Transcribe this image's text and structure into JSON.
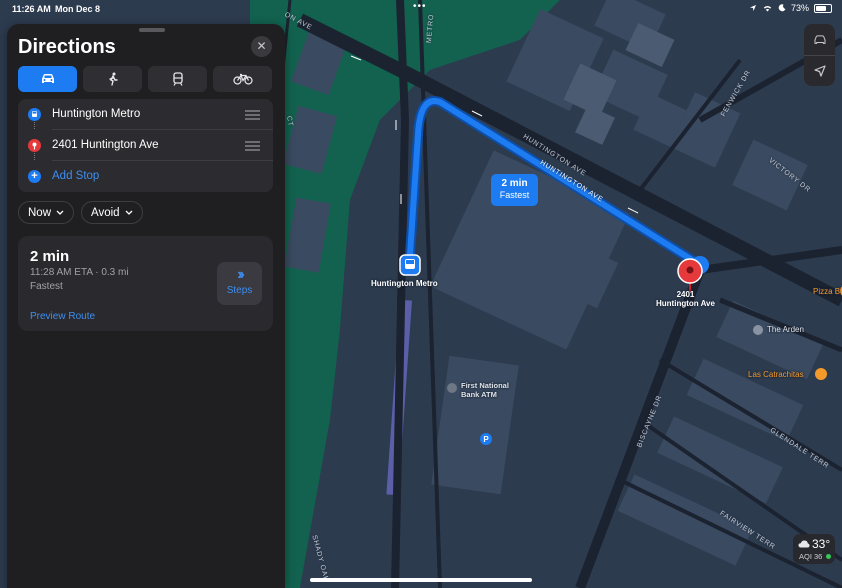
{
  "status_bar": {
    "time": "11:26 AM",
    "date": "Mon Dec 8",
    "battery": "73%",
    "battery_level": 0.73
  },
  "panel": {
    "title": "Directions",
    "close_icon": "xmark-icon",
    "transport_modes": [
      {
        "name": "car-icon",
        "active": true
      },
      {
        "name": "walk-icon",
        "active": false
      },
      {
        "name": "transit-icon",
        "active": false
      },
      {
        "name": "bike-icon",
        "active": false
      }
    ],
    "stops": [
      {
        "label": "Huntington Metro",
        "icon": "transit-stop-icon",
        "color": "#1d7cf2"
      },
      {
        "label": "2401 Huntington Ave",
        "icon": "pin-icon",
        "color": "#e5393b"
      }
    ],
    "add_stop_label": "Add Stop",
    "options": {
      "when_label": "Now",
      "avoid_label": "Avoid"
    },
    "route": {
      "duration": "2 min",
      "eta": "11:28 AM ETA · 0.3 mi",
      "tag": "Fastest",
      "steps_label": "Steps",
      "preview_label": "Preview Route"
    }
  },
  "map": {
    "callout": {
      "duration": "2 min",
      "tag": "Fastest"
    },
    "origin_label": "Huntington Metro",
    "destination_label": "2401\nHuntington Ave",
    "pois": {
      "atm": "First National\nBank ATM",
      "arden": "The Arden",
      "las_catrachitas": "Las Catrachitas",
      "pizza": "Pizza B"
    },
    "streets": {
      "huntington_ave_1": "HUNTINGTON AVE",
      "huntington_ave_2": "HUNTINGTON AVE",
      "metro": "METRO",
      "fenwick": "FENWICK DR",
      "victory": "VICTORY DR",
      "biscayne": "BISCAYNE DR",
      "glendale": "GLENDALE TERR",
      "fairview": "FAIRVIEW TERR",
      "shady_oak": "SHADY OAK",
      "ct": "CT",
      "ave_top": "ON AVE"
    },
    "weather": {
      "temp": "33°",
      "aqi": "AQI 36",
      "icon": "cloud-icon"
    },
    "colors": {
      "route": "#1d7cf2",
      "water": "#12624f",
      "land": "#2c3a4e"
    }
  }
}
